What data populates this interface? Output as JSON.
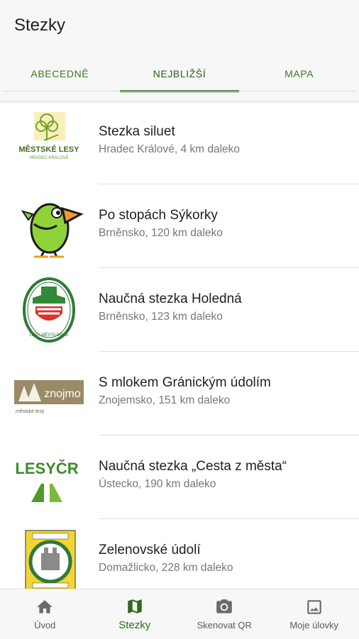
{
  "header": {
    "title": "Stezky"
  },
  "tabs": [
    {
      "label": "ABECEDNĚ"
    },
    {
      "label": "NEJBLIŽŠÍ"
    },
    {
      "label": "MAPA"
    }
  ],
  "active_tab": 1,
  "trails": [
    {
      "name": "Stezka siluet",
      "subtitle": "Hradec Králové, 4 km daleko",
      "logo_text_1": "MĚSTSKÉ LESY",
      "logo_text_2": "HRADEC KRÁLOVÉ",
      "logo": "mestske-lesy-hk-logo"
    },
    {
      "name": "Po stopách Sýkorky",
      "subtitle": "Brněnsko, 120 km daleko",
      "logo": "green-bird-logo"
    },
    {
      "name": "Naučná stezka Holedná",
      "subtitle": "Brněnsko, 123 km daleko",
      "logo_text_1": "LESY MĚSTA BRNA",
      "logo": "lesy-mesta-brna-logo"
    },
    {
      "name": "S mlokem Gránickým údolím",
      "subtitle": "Znojemsko, 151 km daleko",
      "logo_text_1": "znojmo",
      "logo_text_2": "městské lesy",
      "logo": "znojmo-lesy-logo"
    },
    {
      "name": "Naučná stezka „Cesta z města“",
      "subtitle": "Ústecko, 190 km daleko",
      "logo_text_1": "LESYČR",
      "logo": "lesy-cr-logo"
    },
    {
      "name": "Zelenovské údolí",
      "subtitle": "Domažlicko, 228 km daleko",
      "logo": "domazlice-crest-logo"
    }
  ],
  "bottom_nav": [
    {
      "label": "Úvod",
      "icon": "home-icon"
    },
    {
      "label": "Stezky",
      "icon": "map-icon"
    },
    {
      "label": "Skenovat QR",
      "icon": "camera-icon"
    },
    {
      "label": "Moje úlovky",
      "icon": "gallery-icon"
    }
  ],
  "colors": {
    "accent": "#2f6b1d",
    "tab_text": "#3a7a22",
    "bar_bg": "#f7f7f7",
    "nav_icon": "#6b6b6b"
  }
}
